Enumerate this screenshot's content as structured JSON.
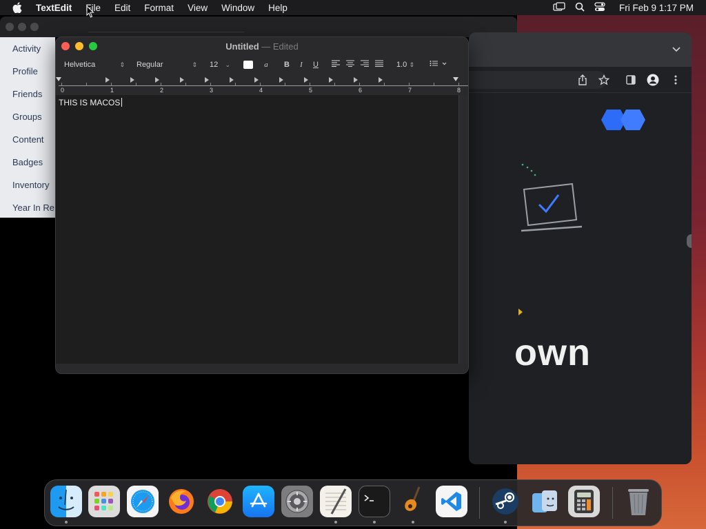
{
  "menubar": {
    "app_name": "TextEdit",
    "items": [
      "File",
      "Edit",
      "Format",
      "View",
      "Window",
      "Help"
    ],
    "clock": "Fri Feb 9  1:17 PM"
  },
  "background_app": {
    "nav_items": [
      "Activity",
      "Profile",
      "Friends",
      "Groups",
      "Content",
      "Badges",
      "Inventory",
      "Year In Re"
    ]
  },
  "chrome": {
    "partial_heading": "own"
  },
  "textedit": {
    "title": "Untitled",
    "separator": " — ",
    "status": "Edited",
    "font_family": "Helvetica",
    "font_style": "Regular",
    "font_size": "12",
    "line_spacing": "1.0",
    "bold_label": "B",
    "italic_label": "I",
    "underline_label": "U",
    "ruler_numbers": [
      "0",
      "1",
      "2",
      "3",
      "4",
      "5",
      "6",
      "7",
      "8"
    ],
    "document_text": "THIS IS MACOS"
  },
  "dock": {
    "apps": [
      "Finder",
      "Launchpad",
      "Safari",
      "Firefox",
      "Chrome",
      "App Store",
      "System Preferences",
      "TextEdit",
      "Terminal",
      "GarageBand",
      "Visual Studio Code",
      "Steam",
      "Migration Assistant",
      "Calculator",
      "Trash"
    ]
  }
}
